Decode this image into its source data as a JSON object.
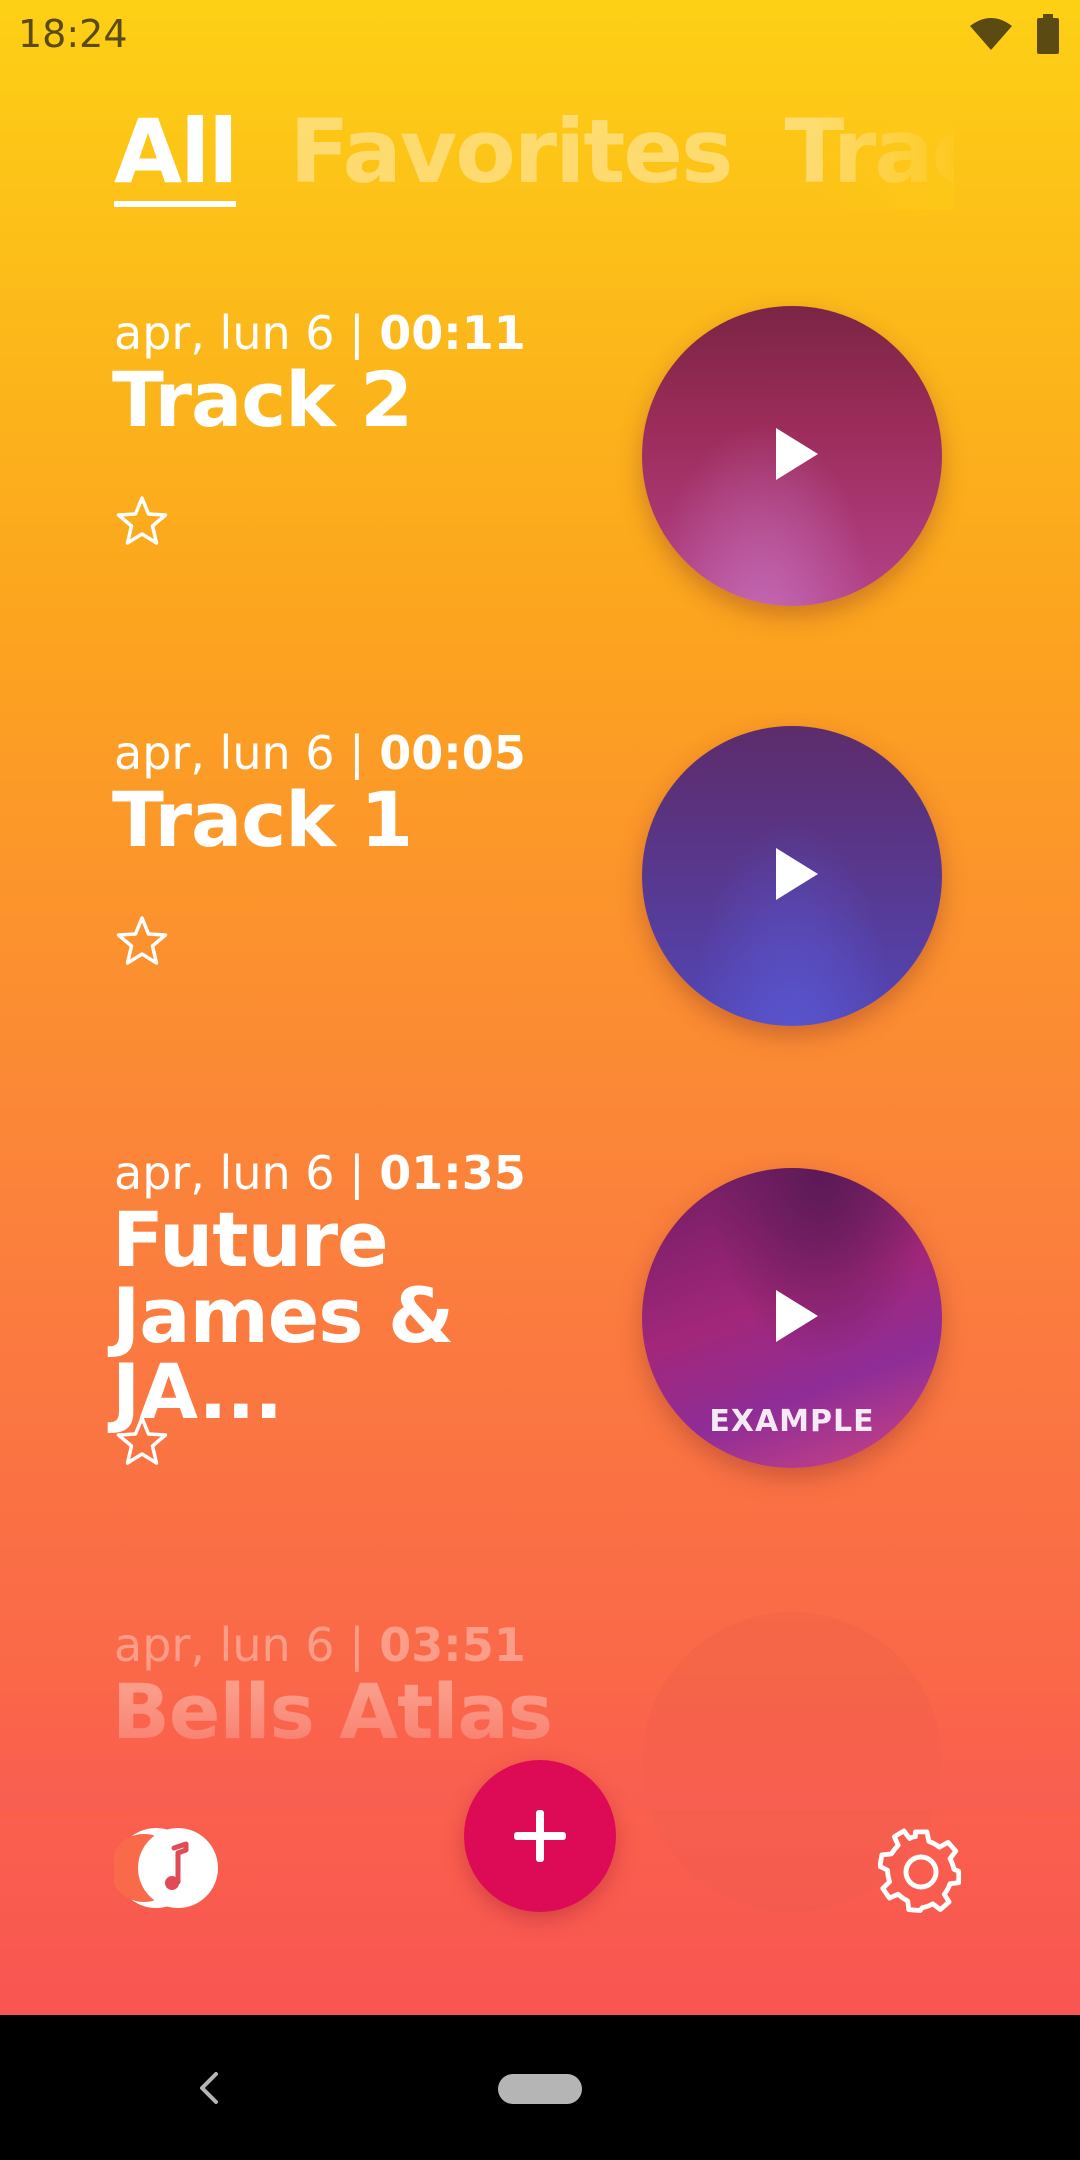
{
  "status": {
    "time": "18:24"
  },
  "tabs": [
    {
      "label": "All",
      "active": true
    },
    {
      "label": "Favorites",
      "active": false
    },
    {
      "label": "Tracks",
      "active": false
    }
  ],
  "tracks": [
    {
      "date": "apr, lun 6 |",
      "duration": "00:11",
      "title": "Track 2",
      "favorite": false,
      "badge": ""
    },
    {
      "date": "apr, lun 6 |",
      "duration": "00:05",
      "title": "Track 1",
      "favorite": false,
      "badge": ""
    },
    {
      "date": "apr, lun 6 |",
      "duration": "01:35",
      "title": "Future James & JA...",
      "favorite": false,
      "badge": "EXAMPLE"
    },
    {
      "date": "apr, lun 6 |",
      "duration": "03:51",
      "title": "Bells Atlas",
      "favorite": false,
      "badge": ""
    }
  ],
  "bottom_bar": {
    "logo_icon": "app-logo-music-icon",
    "add_icon": "plus-icon",
    "settings_icon": "gear-icon"
  },
  "colors": {
    "gradient_top": "#fdd015",
    "gradient_bottom": "#f95552",
    "fab": "#dd0a55"
  }
}
